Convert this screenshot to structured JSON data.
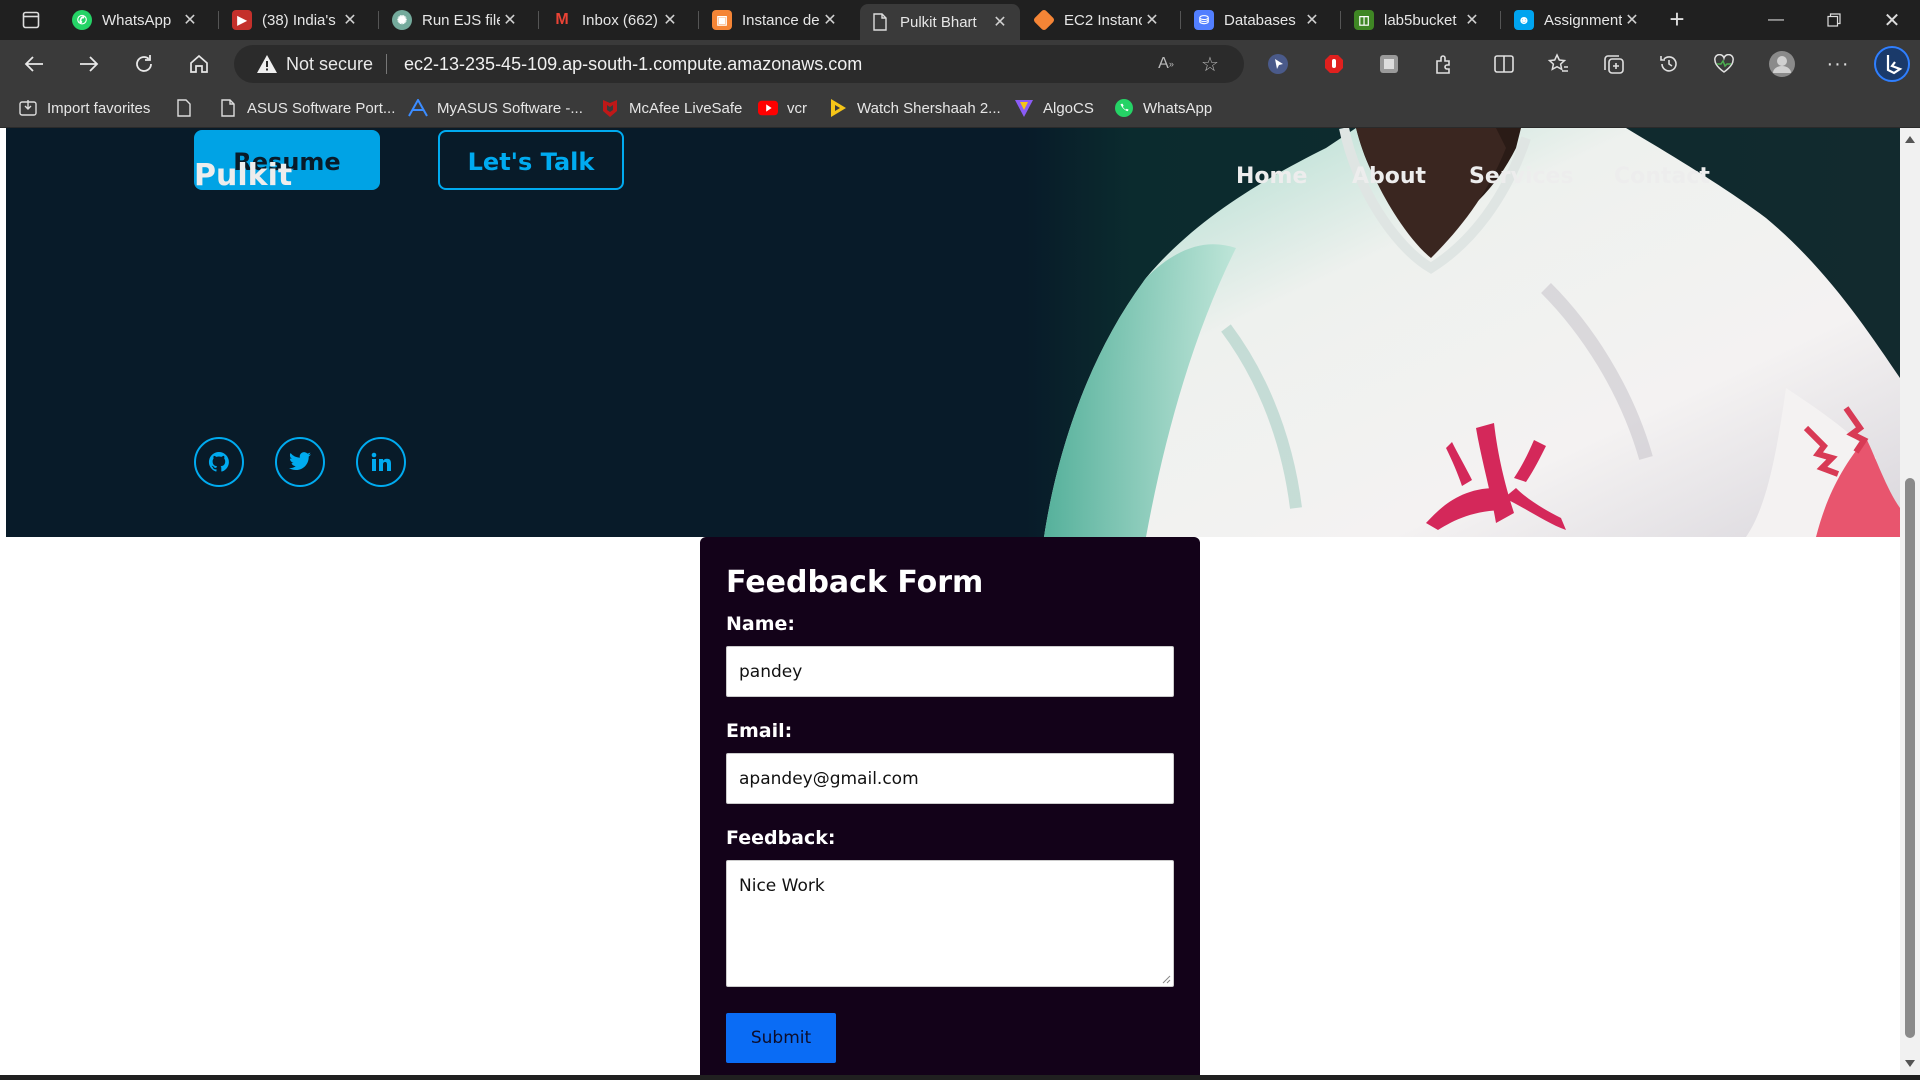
{
  "browser": {
    "tabs": [
      {
        "label": "WhatsApp",
        "fav_color": "#25d366",
        "icon": "whatsapp-icon"
      },
      {
        "label": "(38) India's",
        "fav_color": "#ff0000",
        "icon": "youtube-icon"
      },
      {
        "label": "Run EJS file",
        "fav_color": "#74aa9c",
        "icon": "chatgpt-icon"
      },
      {
        "label": "Inbox (662)",
        "fav_color": "#ea4335",
        "icon": "gmail-icon"
      },
      {
        "label": "Instance de",
        "fav_color": "#f58536",
        "icon": "aws-icon"
      },
      {
        "label": "Pulkit Bhart",
        "fav_color": "#3a3a3a",
        "icon": "page-icon"
      },
      {
        "label": "EC2 Instanc",
        "fav_color": "#f58536",
        "icon": "ec2-icon"
      },
      {
        "label": "Databases",
        "fav_color": "#527fff",
        "icon": "rds-icon"
      },
      {
        "label": "lab5bucket",
        "fav_color": "#3f8624",
        "icon": "s3-icon"
      },
      {
        "label": "Assignment",
        "fav_color": "#00a4ef",
        "icon": "classroom-icon"
      }
    ],
    "active_tab_index": 5,
    "security_label": "Not secure",
    "url": "ec2-13-235-45-109.ap-south-1.compute.amazonaws.com"
  },
  "favorites": [
    {
      "label": "Import favorites",
      "icon": "import-icon"
    },
    {
      "label": "ASUS Software Port...",
      "icon": "page-icon"
    },
    {
      "label": "MyASUS Software -...",
      "icon": "myasus-icon"
    },
    {
      "label": "McAfee LiveSafe",
      "icon": "mcafee-icon"
    },
    {
      "label": "vcr",
      "icon": "youtube-icon"
    },
    {
      "label": "Watch Shershaah 2...",
      "icon": "play-icon"
    },
    {
      "label": "AlgoCS",
      "icon": "algocs-icon"
    },
    {
      "label": "WhatsApp",
      "icon": "whatsapp-icon"
    }
  ],
  "site": {
    "logo": "Pulkit",
    "resume_button": "Resume",
    "talk_button": "Let's Talk",
    "nav": [
      "Home",
      "About",
      "Services",
      "Contact"
    ],
    "accent_color": "#00abf0",
    "hero_bg": "#081b29"
  },
  "form": {
    "title": "Feedback Form",
    "name_label": "Name:",
    "name_value": "pandey",
    "email_label": "Email:",
    "email_value": "apandey@gmail.com",
    "feedback_label": "Feedback:",
    "feedback_value": "Nice Work",
    "submit_label": "Submit"
  }
}
